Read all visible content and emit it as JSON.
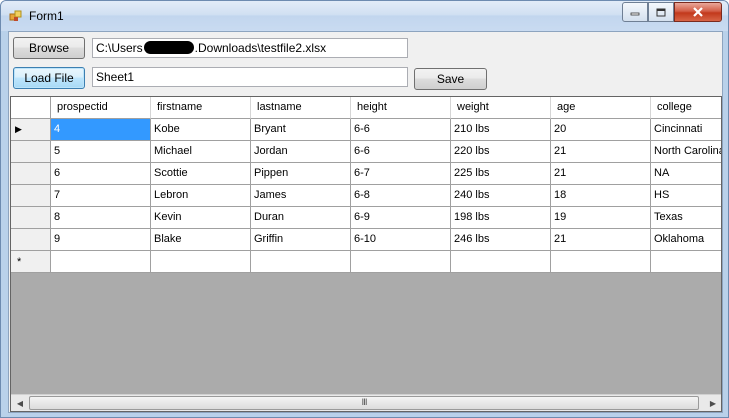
{
  "window": {
    "title": "Form1"
  },
  "controls": {
    "browse_label": "Browse",
    "load_label": "Load File",
    "save_label": "Save",
    "path_prefix": "C:\\Users",
    "path_suffix": ".Downloads\\testfile2.xlsx",
    "sheet_value": "Sheet1"
  },
  "grid": {
    "columns": [
      "prospectid",
      "firstname",
      "lastname",
      "height",
      "weight",
      "age",
      "college"
    ],
    "rows": [
      [
        "4",
        "Kobe",
        "Bryant",
        "6-6",
        "210 lbs",
        "20",
        "Cincinnati"
      ],
      [
        "5",
        "Michael",
        "Jordan",
        "6-6",
        "220 lbs",
        "21",
        "North Carolina"
      ],
      [
        "6",
        "Scottie",
        "Pippen",
        "6-7",
        "225 lbs",
        "21",
        "NA"
      ],
      [
        "7",
        "Lebron",
        "James",
        "6-8",
        "240 lbs",
        "18",
        "HS"
      ],
      [
        "8",
        "Kevin",
        "Duran",
        "6-9",
        "198 lbs",
        "19",
        "Texas"
      ],
      [
        "9",
        "Blake",
        "Griffin",
        "6-10",
        "246 lbs",
        "21",
        "Oklahoma"
      ]
    ],
    "current_row_marker": "▶",
    "new_row_marker": "*",
    "scroll_grip": "III"
  },
  "icons": {
    "app": "app-icon",
    "minimize": "minimize-icon",
    "maximize": "maximize-icon",
    "close": "close-icon",
    "scroll_left": "chevron-left-icon",
    "scroll_right": "chevron-right-icon"
  }
}
